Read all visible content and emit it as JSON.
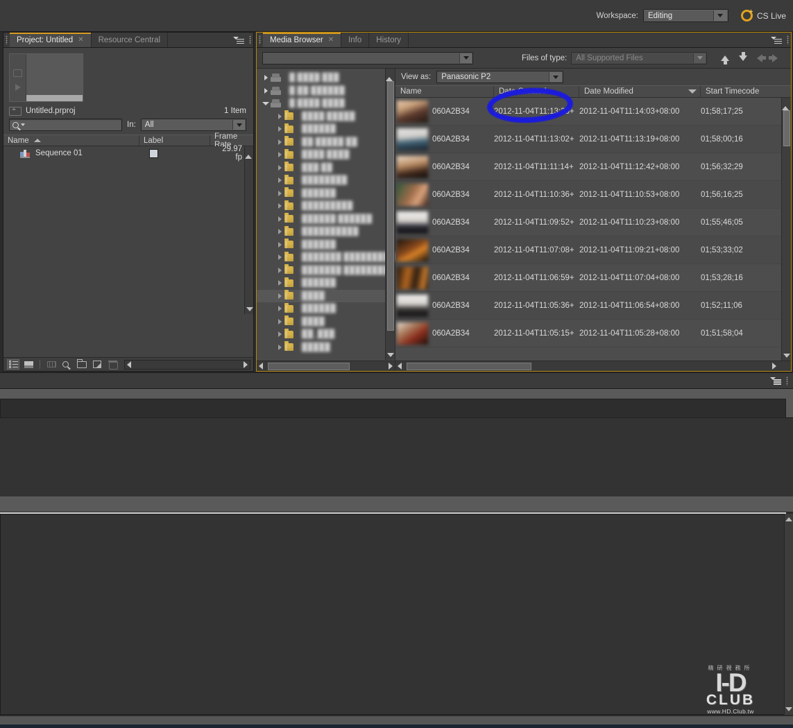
{
  "topbar": {
    "workspace_label": "Workspace:",
    "workspace_value": "Editing",
    "cslive_label": "CS Live"
  },
  "project_panel": {
    "tabs": [
      {
        "label": "Project: Untitled",
        "active": true,
        "closable": true
      },
      {
        "label": "Resource Central",
        "active": false,
        "closable": false
      }
    ],
    "file_name": "Untitled.prproj",
    "item_count": "1 Item",
    "search_placeholder": "",
    "in_label": "In:",
    "in_value": "All",
    "columns": [
      "Name",
      "Label",
      "Frame Rate"
    ],
    "rows": [
      {
        "name": "Sequence 01",
        "label": "",
        "frame_rate": "29.97 fp"
      }
    ]
  },
  "media_browser": {
    "tabs": [
      {
        "label": "Media Browser",
        "active": true,
        "closable": true
      },
      {
        "label": "Info",
        "active": false,
        "closable": false
      },
      {
        "label": "History",
        "active": false,
        "closable": false
      }
    ],
    "path_value": "",
    "files_of_type_label": "Files of type:",
    "files_of_type_value": "All Supported Files",
    "view_as_label": "View as:",
    "view_as_value": "Panasonic P2",
    "columns": [
      "Name",
      "Date Created",
      "Date Modified",
      "Start Timecode"
    ],
    "sorted_column": "Date Modified",
    "tree": [
      {
        "indent": 0,
        "type": "drive",
        "expanded": false,
        "label": "█ ████ ███"
      },
      {
        "indent": 0,
        "type": "drive",
        "expanded": false,
        "label": "█ ██ ██████"
      },
      {
        "indent": 0,
        "type": "drive",
        "expanded": true,
        "label": "█ ████ ████"
      },
      {
        "indent": 1,
        "type": "folder",
        "expanded": false,
        "label": "████ █████"
      },
      {
        "indent": 1,
        "type": "folder",
        "expanded": false,
        "label": "██████"
      },
      {
        "indent": 1,
        "type": "folder",
        "expanded": false,
        "label": "██ █████ ██"
      },
      {
        "indent": 1,
        "type": "folder",
        "expanded": false,
        "label": "████ ████"
      },
      {
        "indent": 1,
        "type": "folder",
        "expanded": false,
        "label": "███ ██"
      },
      {
        "indent": 1,
        "type": "folder",
        "expanded": false,
        "label": "████████"
      },
      {
        "indent": 1,
        "type": "folder",
        "expanded": false,
        "label": "██████"
      },
      {
        "indent": 1,
        "type": "folder",
        "expanded": false,
        "label": "█████████"
      },
      {
        "indent": 1,
        "type": "folder",
        "expanded": false,
        "label": "██████ ██████"
      },
      {
        "indent": 1,
        "type": "folder",
        "expanded": false,
        "label": "██████████"
      },
      {
        "indent": 1,
        "type": "folder",
        "expanded": false,
        "label": "██████"
      },
      {
        "indent": 1,
        "type": "folder",
        "expanded": false,
        "label": "███████ █████████"
      },
      {
        "indent": 1,
        "type": "folder",
        "expanded": false,
        "label": "███████ ████████"
      },
      {
        "indent": 1,
        "type": "folder",
        "expanded": false,
        "label": "██████"
      },
      {
        "indent": 1,
        "type": "folder",
        "expanded": false,
        "label": "████",
        "selected": true
      },
      {
        "indent": 1,
        "type": "folder",
        "expanded": false,
        "label": "██████"
      },
      {
        "indent": 1,
        "type": "folder",
        "expanded": false,
        "label": "████"
      },
      {
        "indent": 1,
        "type": "folder",
        "expanded": false,
        "label": "██_███"
      },
      {
        "indent": 1,
        "type": "folder",
        "expanded": false,
        "label": "█████"
      }
    ],
    "rows": [
      {
        "name": "060A2B34",
        "date_created": "2012-11-04T11:13:36+",
        "date_modified": "2012-11-04T11:14:03+08:00",
        "start_timecode": "01;58;17;25",
        "thumb": "linear-gradient(160deg,#e8c9b0 0%,#c9a07a 30%,#5d3b2e 58%,#201712 100%)"
      },
      {
        "name": "060A2B34",
        "date_created": "2012-11-04T11:13:02+",
        "date_modified": "2012-11-04T11:13:19+08:00",
        "start_timecode": "01;58;00;16",
        "thumb": "linear-gradient(175deg,#e7e6e4 0%,#cfcdc9 38%,#3f5f72 62%,#17202a 100%)"
      },
      {
        "name": "060A2B34",
        "date_created": "2012-11-04T11:11:14+",
        "date_modified": "2012-11-04T11:12:42+08:00",
        "start_timecode": "01;56;32;29",
        "thumb": "linear-gradient(170deg,#ecdcc9 0%,#b98b63 40%,#41281c 70%,#120d0a 100%)"
      },
      {
        "name": "060A2B34",
        "date_created": "2012-11-04T11:10:36+",
        "date_modified": "2012-11-04T11:10:53+08:00",
        "start_timecode": "01;56;16;25",
        "thumb": "linear-gradient(120deg,#2f5a3a 0%,#9c6b4a 45%,#d9a27b 70%,#3a1f16 100%)"
      },
      {
        "name": "060A2B34",
        "date_created": "2012-11-04T11:09:52+",
        "date_modified": "2012-11-04T11:10:23+08:00",
        "start_timecode": "01;55;46;05",
        "thumb": "linear-gradient(180deg,#f0eeec 0%,#d6d3cf 42%,#2b2b33 68%,#101014 100%)"
      },
      {
        "name": "060A2B34",
        "date_created": "2012-11-04T11:07:08+",
        "date_modified": "2012-11-04T11:09:21+08:00",
        "start_timecode": "01;53;33;02",
        "thumb": "linear-gradient(150deg,#1a120c 0%,#8a4a1c 45%,#d98227 62%,#140d08 100%)"
      },
      {
        "name": "060A2B34",
        "date_created": "2012-11-04T11:06:59+",
        "date_modified": "2012-11-04T11:07:04+08:00",
        "start_timecode": "01;53;28;16",
        "thumb": "linear-gradient(100deg,#21160f 0%,#b4661f 35%,#2a1c12 60%,#c97a2a 85%,#171009 100%)"
      },
      {
        "name": "060A2B34",
        "date_created": "2012-11-04T11:05:36+",
        "date_modified": "2012-11-04T11:06:54+08:00",
        "start_timecode": "01;52;11;06",
        "thumb": "linear-gradient(180deg,#efedeb 0%,#d8d5d1 40%,#33312f 66%,#131211 100%)"
      },
      {
        "name": "060A2B34",
        "date_created": "2012-11-04T11:05:15+",
        "date_modified": "2012-11-04T11:05:28+08:00",
        "start_timecode": "01;51;58;04",
        "thumb": "linear-gradient(145deg,#e6dcd2 0%,#a8795a 35%,#8c2f1e 62%,#1b0f0a 100%)"
      }
    ]
  },
  "watermark": {
    "cjk": "精研視務所",
    "hd": "I-D",
    "club": "CLUB",
    "url": "www.HD.Club.tw"
  },
  "colors": {
    "accent_orange": "#d79b22",
    "marker_blue": "#1a1ae0",
    "panel_bg": "#434343",
    "folder_yellow": "#d8b44a"
  }
}
